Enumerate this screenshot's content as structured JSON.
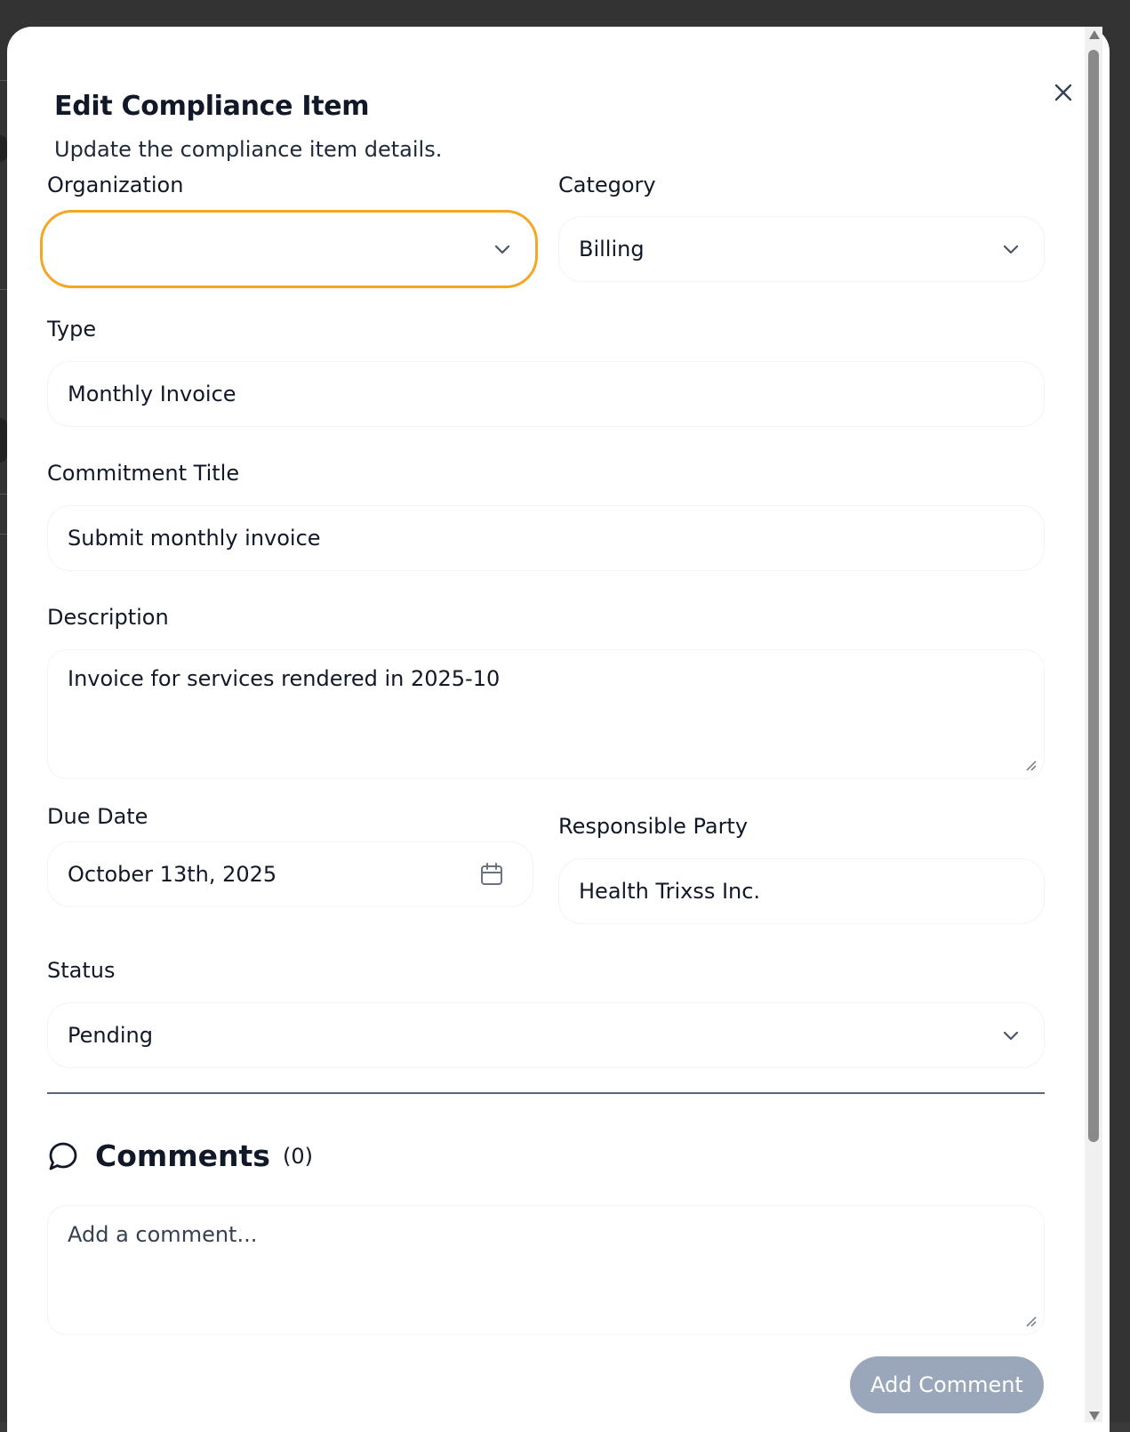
{
  "dialog": {
    "title": "Edit Compliance Item",
    "subtitle": "Update the compliance item details."
  },
  "form": {
    "organization": {
      "label": "Organization",
      "value": ""
    },
    "category": {
      "label": "Category",
      "value": "Billing"
    },
    "type": {
      "label": "Type",
      "value": "Monthly Invoice"
    },
    "commitment_title": {
      "label": "Commitment Title",
      "value": "Submit monthly invoice"
    },
    "description": {
      "label": "Description",
      "value": "Invoice for services rendered in 2025-10"
    },
    "due_date": {
      "label": "Due Date",
      "value": "October 13th, 2025"
    },
    "responsible_party": {
      "label": "Responsible Party",
      "value": "Health Trixss Inc."
    },
    "status": {
      "label": "Status",
      "value": "Pending"
    }
  },
  "comments": {
    "title": "Comments",
    "count": "(0)",
    "placeholder": "Add a comment...",
    "add_button": "Add Comment"
  },
  "colors": {
    "focus_ring": "#f5a623",
    "button_disabled": "#9aa6ba",
    "divider": "#5b6778"
  },
  "icons": {
    "close": "close-icon",
    "chevron": "chevron-down-icon",
    "calendar": "calendar-icon",
    "comment": "message-circle-icon"
  }
}
